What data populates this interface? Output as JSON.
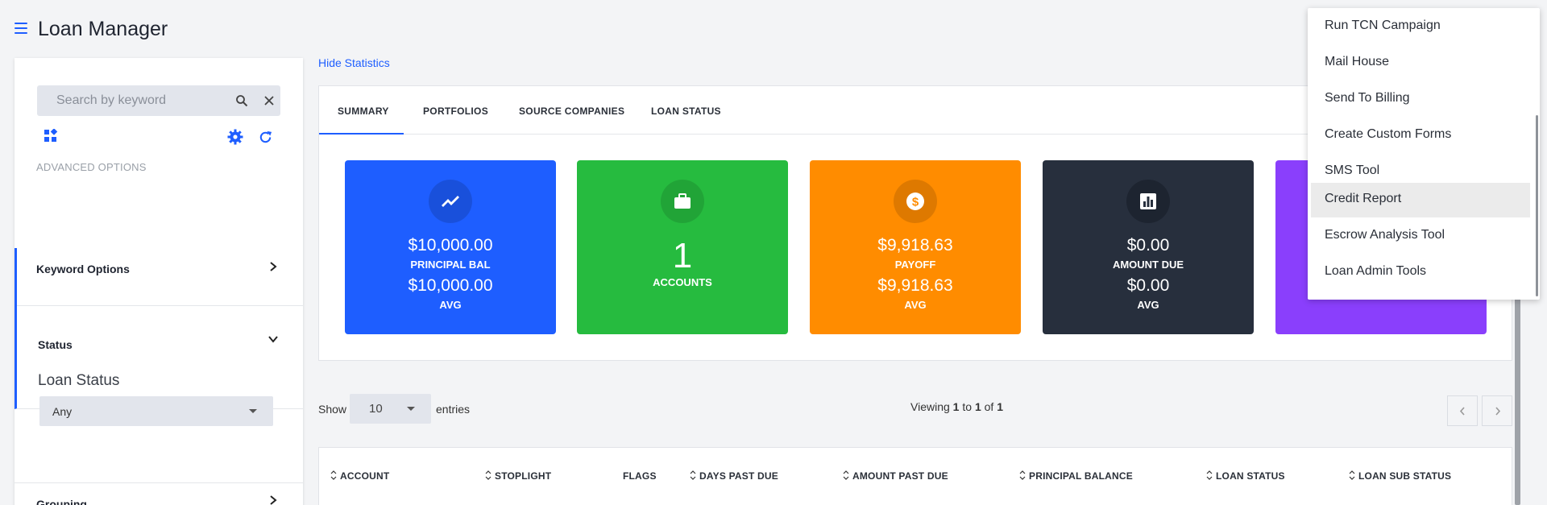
{
  "app": {
    "title": "Loan Manager"
  },
  "sidebar": {
    "search_placeholder": "Search by keyword",
    "advanced_label": "ADVANCED OPTIONS",
    "keyword_options": "Keyword Options",
    "status": "Status",
    "loan_status_label": "Loan Status",
    "loan_status_value": "Any",
    "grouping": "Grouping"
  },
  "main": {
    "hide_statistics": "Hide Statistics",
    "tabs": [
      {
        "label": "SUMMARY"
      },
      {
        "label": "PORTFOLIOS"
      },
      {
        "label": "SOURCE COMPANIES"
      },
      {
        "label": "LOAN STATUS"
      }
    ],
    "cards": [
      {
        "value": "$10,000.00",
        "label": "PRINCIPAL BAL",
        "avg": "$10,000.00",
        "avg_label": "AVG",
        "color": "#1e5eff"
      },
      {
        "value": "1",
        "label": "ACCOUNTS",
        "color": "#26bb3f"
      },
      {
        "value": "$9,918.63",
        "label": "PAYOFF",
        "avg": "$9,918.63",
        "avg_label": "AVG",
        "color": "#ff8c00"
      },
      {
        "value": "$0.00",
        "label": "AMOUNT DUE",
        "avg": "$0.00",
        "avg_label": "AVG",
        "color": "#272f3d"
      },
      {
        "color": "#8a3ffc"
      }
    ]
  },
  "table": {
    "show": "Show",
    "entries_value": "10",
    "entries": "entries",
    "viewing_prefix": "Viewing",
    "from": "1",
    "to_word": "to",
    "to": "1",
    "of_word": "of",
    "total": "1",
    "columns": [
      "ACCOUNT",
      "STOPLIGHT",
      "FLAGS",
      "DAYS PAST DUE",
      "AMOUNT PAST DUE",
      "PRINCIPAL BALANCE",
      "LOAN STATUS",
      "LOAN SUB STATUS"
    ]
  },
  "menu": {
    "items": [
      {
        "label": "Run TCN Campaign"
      },
      {
        "label": "Mail House"
      },
      {
        "label": "Send To Billing"
      },
      {
        "label": "Create Custom Forms"
      },
      {
        "label": "SMS Tool"
      },
      {
        "label": "Credit Report"
      },
      {
        "label": "Escrow Analysis Tool"
      },
      {
        "label": "Loan Admin Tools"
      }
    ]
  }
}
